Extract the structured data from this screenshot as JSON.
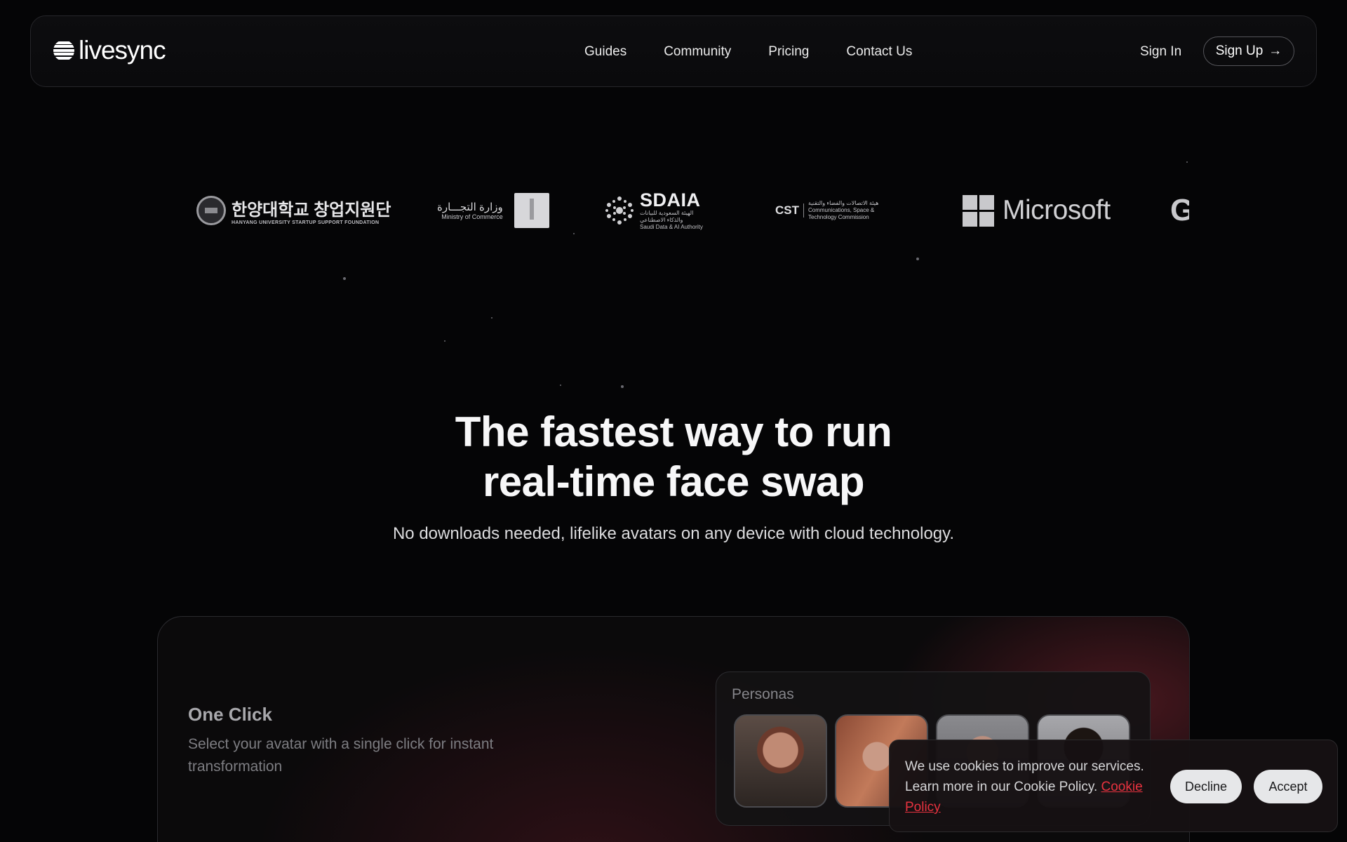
{
  "brand": {
    "name": "livesync"
  },
  "nav": {
    "links": [
      "Guides",
      "Community",
      "Pricing",
      "Contact Us"
    ],
    "sign_in": "Sign In",
    "sign_up": "Sign Up",
    "sign_up_icon": "→"
  },
  "logos": {
    "hanyang": {
      "main": "한양대학교 창업지원단",
      "sub": "HANYANG UNIVERSITY STARTUP SUPPORT FOUNDATION"
    },
    "moc": {
      "ar": "وزارة التجـــارة",
      "en": "Ministry of Commerce"
    },
    "sdaia": {
      "main": "SDAIA",
      "ar1": "الهيئة السعودية للبيانات",
      "ar2": "والذكاء الاصطناعي",
      "en": "Saudi Data & AI Authority"
    },
    "cst": {
      "mark": "CST",
      "ar": "هيئة الاتصالات والفضاء والتقنية",
      "en1": "Communications, Space &",
      "en2": "Technology Commission"
    },
    "microsoft": {
      "name": "Microsoft"
    },
    "partial": {
      "letter": "G"
    }
  },
  "hero": {
    "title_line1": "The fastest way to run",
    "title_line2": "real-time face swap",
    "subtitle": "No downloads needed, lifelike avatars on any device with cloud technology."
  },
  "feature": {
    "title": "One Click",
    "description": "Select your avatar with a single click for instant transformation",
    "personas_label": "Personas"
  },
  "cookie": {
    "text": "We use cookies to improve our services. Learn more in our Cookie Policy.",
    "link": "Cookie Policy",
    "decline": "Decline",
    "accept": "Accept"
  },
  "colors": {
    "background": "#050506",
    "accent": "#e8323f"
  }
}
